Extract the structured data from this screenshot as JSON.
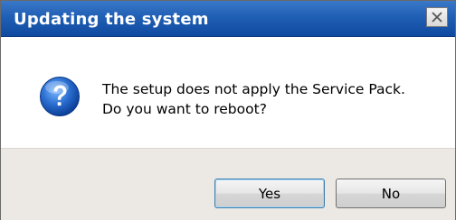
{
  "dialog": {
    "title": "Updating the system",
    "message_line1": "The setup does not apply the Service Pack.",
    "message_line2": "Do you want to reboot?",
    "icon": "question-icon",
    "buttons": {
      "yes": "Yes",
      "no": "No"
    },
    "close_icon": "close-icon"
  },
  "colors": {
    "titlebar": "#1f5fb4",
    "footer": "#ece9e4",
    "icon_blue": "#1d5fbf"
  }
}
